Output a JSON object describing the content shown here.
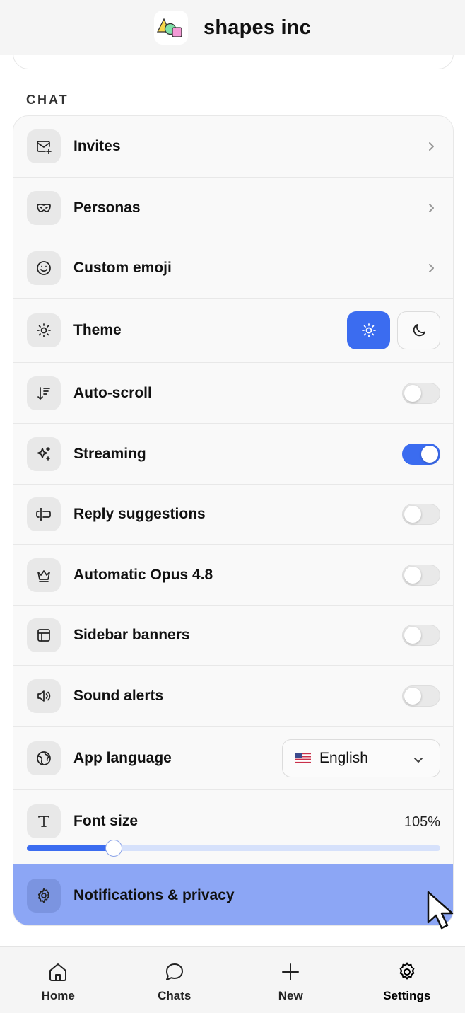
{
  "header": {
    "title": "shapes inc"
  },
  "section": {
    "title": "CHAT"
  },
  "rows": {
    "invites": {
      "label": "Invites",
      "icon": "mail-plus-icon"
    },
    "personas": {
      "label": "Personas",
      "icon": "mask-icon"
    },
    "custom_emoji": {
      "label": "Custom emoji",
      "icon": "smiley-icon"
    },
    "theme": {
      "label": "Theme",
      "icon": "sun-icon",
      "selected": "light"
    },
    "auto_scroll": {
      "label": "Auto-scroll",
      "icon": "arrow-down-lines-icon",
      "enabled": false
    },
    "streaming": {
      "label": "Streaming",
      "icon": "sparkles-icon",
      "enabled": true
    },
    "reply_suggestions": {
      "label": "Reply suggestions",
      "icon": "text-cursor-icon",
      "enabled": false
    },
    "automatic_opus": {
      "label": "Automatic Opus 4.8",
      "icon": "crown-icon",
      "enabled": false
    },
    "sidebar_banners": {
      "label": "Sidebar banners",
      "icon": "layout-icon",
      "enabled": false
    },
    "sound_alerts": {
      "label": "Sound alerts",
      "icon": "speaker-icon",
      "enabled": false
    },
    "app_language": {
      "label": "App language",
      "icon": "globe-icon",
      "value": "English",
      "flag": "us-flag"
    },
    "font_size": {
      "label": "Font size",
      "icon": "type-icon",
      "value": "105%",
      "level": 0.21
    },
    "notifications": {
      "label": "Notifications & privacy",
      "icon": "gear-icon"
    }
  },
  "tabs": [
    {
      "label": "Home",
      "icon": "home-icon"
    },
    {
      "label": "Chats",
      "icon": "chat-bubble-icon"
    },
    {
      "label": "New",
      "icon": "plus-icon"
    },
    {
      "label": "Settings",
      "icon": "gear-icon",
      "active": true
    }
  ],
  "colors": {
    "accent": "#3b6cf0",
    "highlight": "#8ca6f5"
  }
}
